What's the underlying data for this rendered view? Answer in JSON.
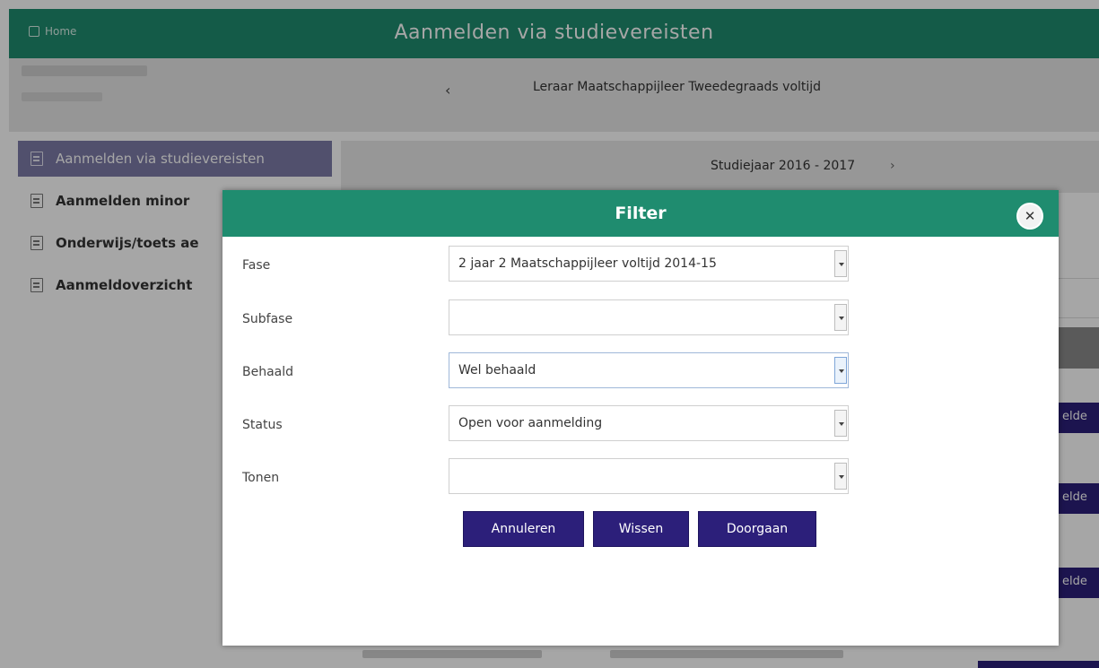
{
  "header": {
    "home_label": "Home",
    "title": "Aanmelden via studievereisten"
  },
  "program": {
    "prev_icon": "chevron-left-icon",
    "title": "Leraar Maatschappijleer Tweedegraads voltijd"
  },
  "sidebar": {
    "items": [
      {
        "label": "Aanmelden via studievereisten",
        "icon": "list-icon",
        "active": true
      },
      {
        "label": "Aanmelden minor",
        "icon": "edit-icon",
        "active": false
      },
      {
        "label": "Onderwijs/toets ae",
        "icon": "edit-icon",
        "active": false
      },
      {
        "label": "Aanmeldoverzicht",
        "icon": "list-icon",
        "active": false
      }
    ]
  },
  "content": {
    "year_label": "Studiejaar 2016 - 2017",
    "year_next_icon": "chevron-right-icon",
    "side_button_label": "elde"
  },
  "dialog": {
    "title": "Filter",
    "close_icon": "close-icon",
    "fields": [
      {
        "label": "Fase",
        "value": "2 jaar 2 Maatschappijleer voltijd 2014-15"
      },
      {
        "label": "Subfase",
        "value": ""
      },
      {
        "label": "Behaald",
        "value": "Wel behaald"
      },
      {
        "label": "Status",
        "value": "Open voor aanmelding"
      },
      {
        "label": "Tonen",
        "value": ""
      }
    ],
    "buttons": {
      "cancel": "Annuleren",
      "clear": "Wissen",
      "continue": "Doorgaan"
    }
  },
  "colors": {
    "header_green": "#1f8c6f",
    "button_purple": "#2c1f7a",
    "active_nav": "#7d7ca8"
  }
}
